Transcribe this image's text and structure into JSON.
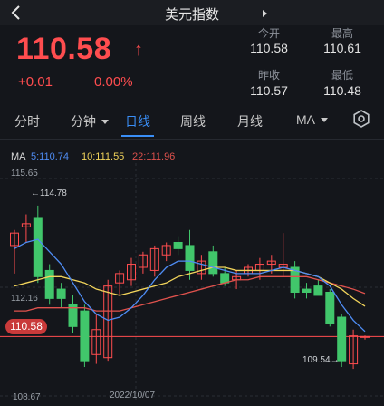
{
  "header": {
    "title": "美元指数"
  },
  "quote": {
    "price": "110.58",
    "arrow": "↑",
    "change": "+0.01",
    "change_pct": "0.00%",
    "stats": [
      {
        "label": "今开",
        "value": "110.58"
      },
      {
        "label": "最高",
        "value": "110.61"
      },
      {
        "label": "昨收",
        "value": "110.57"
      },
      {
        "label": "最低",
        "value": "110.48"
      }
    ]
  },
  "tabs": [
    "分时",
    "分钟",
    "日线",
    "周线",
    "月线",
    "MA"
  ],
  "active_tab": "日线",
  "ma_legend": {
    "ma": "MA",
    "ma5": "5:110.74",
    "ma10": "10:111.55",
    "ma22": "22:111.96"
  },
  "axis": {
    "top": "115.65",
    "mid": "112.16",
    "bottom": "108.67",
    "date": "2022/10/07",
    "last_price": "110.58",
    "max_marker": "←114.78",
    "min_marker": "109.54→"
  },
  "colors": {
    "up": "#ff4d4f",
    "down": "#41c66b",
    "accent": "#3a8ef6",
    "ma5": "#4f8df5",
    "ma10": "#f3d55b",
    "ma22": "#e0524d"
  },
  "chart_data": {
    "type": "candlestick",
    "ylim": [
      108.67,
      115.65
    ],
    "candles": [
      {
        "open": 113.5,
        "high": 114.0,
        "low": 112.6,
        "close": 113.9
      },
      {
        "open": 114.1,
        "high": 114.5,
        "low": 113.6,
        "close": 114.2
      },
      {
        "open": 114.4,
        "high": 114.78,
        "low": 112.3,
        "close": 112.5
      },
      {
        "open": 112.7,
        "high": 112.9,
        "low": 111.6,
        "close": 111.8
      },
      {
        "open": 112.1,
        "high": 112.3,
        "low": 111.5,
        "close": 111.8
      },
      {
        "open": 111.6,
        "high": 111.9,
        "low": 110.7,
        "close": 110.9
      },
      {
        "open": 111.4,
        "high": 111.6,
        "low": 109.6,
        "close": 109.8
      },
      {
        "open": 110.0,
        "high": 111.3,
        "low": 109.7,
        "close": 110.8
      },
      {
        "open": 109.9,
        "high": 112.4,
        "low": 109.8,
        "close": 112.2
      },
      {
        "open": 112.3,
        "high": 112.7,
        "low": 111.9,
        "close": 112.6
      },
      {
        "open": 112.4,
        "high": 113.1,
        "low": 112.2,
        "close": 112.9
      },
      {
        "open": 112.8,
        "high": 113.3,
        "low": 112.6,
        "close": 113.2
      },
      {
        "open": 112.7,
        "high": 113.5,
        "low": 112.5,
        "close": 113.4
      },
      {
        "open": 113.2,
        "high": 113.6,
        "low": 113.0,
        "close": 113.5
      },
      {
        "open": 113.6,
        "high": 113.8,
        "low": 113.2,
        "close": 113.4
      },
      {
        "open": 113.5,
        "high": 114.0,
        "low": 112.4,
        "close": 112.7
      },
      {
        "open": 112.6,
        "high": 113.2,
        "low": 112.4,
        "close": 113.0
      },
      {
        "open": 113.3,
        "high": 113.5,
        "low": 112.5,
        "close": 112.6
      },
      {
        "open": 112.6,
        "high": 112.8,
        "low": 112.2,
        "close": 112.3
      },
      {
        "open": 112.4,
        "high": 112.7,
        "low": 112.1,
        "close": 112.5
      },
      {
        "open": 112.6,
        "high": 112.9,
        "low": 112.5,
        "close": 112.8
      },
      {
        "open": 112.7,
        "high": 113.1,
        "low": 112.4,
        "close": 112.9
      },
      {
        "open": 112.9,
        "high": 113.2,
        "low": 112.6,
        "close": 113.0
      },
      {
        "open": 112.8,
        "high": 113.9,
        "low": 112.5,
        "close": 112.9
      },
      {
        "open": 112.8,
        "high": 113.0,
        "low": 111.8,
        "close": 112.0
      },
      {
        "open": 112.1,
        "high": 112.3,
        "low": 111.8,
        "close": 112.0
      },
      {
        "open": 112.2,
        "high": 112.4,
        "low": 111.9,
        "close": 111.9
      },
      {
        "open": 112.0,
        "high": 112.1,
        "low": 110.9,
        "close": 111.0
      },
      {
        "open": 111.2,
        "high": 111.3,
        "low": 109.6,
        "close": 109.8
      },
      {
        "open": 109.7,
        "high": 110.8,
        "low": 109.54,
        "close": 110.6
      },
      {
        "open": 110.57,
        "high": 110.61,
        "low": 110.48,
        "close": 110.58
      }
    ],
    "ma5": [
      113.4,
      113.6,
      113.7,
      113.3,
      112.9,
      112.3,
      111.7,
      111.3,
      111.1,
      111.2,
      111.5,
      111.9,
      112.4,
      112.8,
      113.0,
      113.0,
      112.9,
      112.8,
      112.7,
      112.6,
      112.6,
      112.6,
      112.7,
      112.8,
      112.7,
      112.6,
      112.5,
      112.2,
      111.6,
      111.1,
      110.74
    ],
    "ma10": [
      112.2,
      112.3,
      112.4,
      112.5,
      112.5,
      112.4,
      112.3,
      112.1,
      112.0,
      111.9,
      112.0,
      112.1,
      112.2,
      112.3,
      112.5,
      112.6,
      112.7,
      112.8,
      112.8,
      112.7,
      112.7,
      112.7,
      112.7,
      112.7,
      112.7,
      112.6,
      112.5,
      112.3,
      112.1,
      111.8,
      111.55
    ],
    "ma22": [
      111.4,
      111.4,
      111.5,
      111.5,
      111.5,
      111.5,
      111.5,
      111.4,
      111.4,
      111.4,
      111.5,
      111.6,
      111.7,
      111.8,
      111.9,
      112.0,
      112.1,
      112.2,
      112.3,
      112.4,
      112.4,
      112.5,
      112.5,
      112.5,
      112.5,
      112.5,
      112.4,
      112.3,
      112.2,
      112.1,
      111.96
    ]
  }
}
